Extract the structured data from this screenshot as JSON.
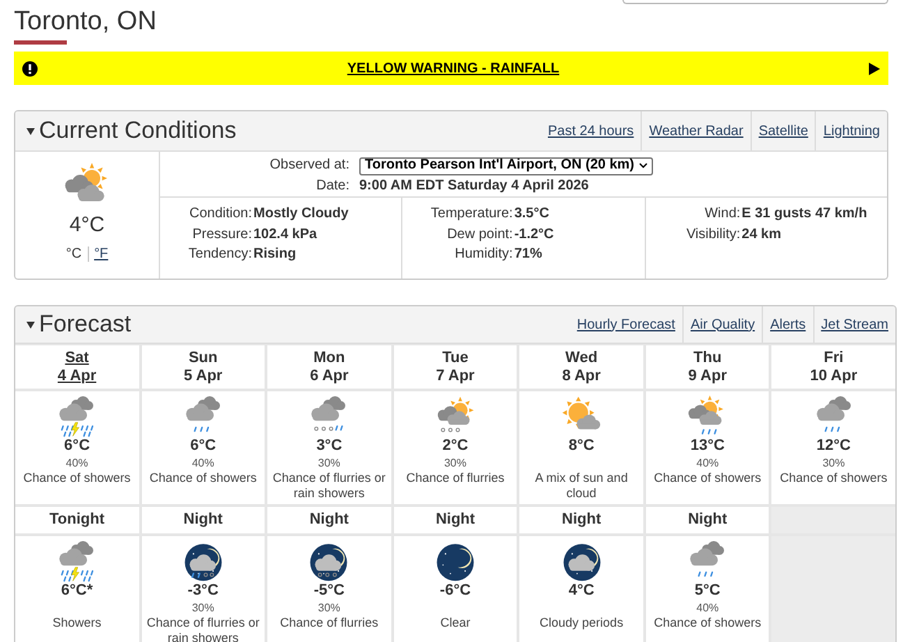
{
  "page_title": "Toronto, ON",
  "warning": {
    "text": "YELLOW WARNING - RAINFALL"
  },
  "current": {
    "title": "Current Conditions",
    "links": [
      "Past 24 hours",
      "Weather Radar",
      "Satellite",
      "Lightning"
    ],
    "kind": "mostly_cloudy",
    "temp": "4°C",
    "units": [
      {
        "label": "°C",
        "selected": true
      },
      {
        "label": "°F",
        "selected": false
      }
    ],
    "observed_label": "Observed at:",
    "station": "Toronto Pearson Int'l Airport, ON (20 km)",
    "date_label": "Date:",
    "date": "9:00 AM EDT Saturday 4 April 2026",
    "columns": [
      [
        {
          "label": "Condition:",
          "value": "Mostly Cloudy"
        },
        {
          "label": "Pressure:",
          "value": "102.4 kPa"
        },
        {
          "label": "Tendency:",
          "value": "Rising"
        }
      ],
      [
        {
          "label": "Temperature:",
          "value": "3.5°C"
        },
        {
          "label": "Dew point:",
          "value": "-1.2°C"
        },
        {
          "label": "Humidity:",
          "value": "71%"
        }
      ],
      [
        {
          "label": "Wind:",
          "value": "E 31 gusts 47 km/h"
        },
        {
          "label": "Visibility:",
          "value": "24 km"
        }
      ]
    ]
  },
  "forecast": {
    "title": "Forecast",
    "links": [
      "Hourly Forecast",
      "Air Quality",
      "Alerts",
      "Jet Stream"
    ],
    "days": [
      {
        "name": "Sat",
        "date": "4 Apr",
        "selected": true,
        "kind": "showers_thunder",
        "temp": "6°C",
        "pop": "40%",
        "summary": "Chance of showers"
      },
      {
        "name": "Sun",
        "date": "5 Apr",
        "selected": false,
        "kind": "showers",
        "temp": "6°C",
        "pop": "40%",
        "summary": "Chance of showers"
      },
      {
        "name": "Mon",
        "date": "6 Apr",
        "selected": false,
        "kind": "flurries_rain",
        "temp": "3°C",
        "pop": "30%",
        "summary": "Chance of flurries or rain showers"
      },
      {
        "name": "Tue",
        "date": "7 Apr",
        "selected": false,
        "kind": "flurries_sun",
        "temp": "2°C",
        "pop": "30%",
        "summary": "Chance of flurries"
      },
      {
        "name": "Wed",
        "date": "8 Apr",
        "selected": false,
        "kind": "sun_cloud",
        "temp": "8°C",
        "summary": "A mix of sun and cloud"
      },
      {
        "name": "Thu",
        "date": "9 Apr",
        "selected": false,
        "kind": "showers_sun",
        "temp": "13°C",
        "pop": "40%",
        "summary": "Chance of showers"
      },
      {
        "name": "Fri",
        "date": "10 Apr",
        "selected": false,
        "kind": "showers",
        "temp": "12°C",
        "pop": "30%",
        "summary": "Chance of showers"
      }
    ],
    "nights": [
      {
        "label": "Tonight",
        "kind": "showers_thunder",
        "temp": "6°C*",
        "summary": "Showers"
      },
      {
        "label": "Night",
        "kind": "night_flurries_rain",
        "temp": "-3°C",
        "pop": "30%",
        "summary": "Chance of flurries or rain showers"
      },
      {
        "label": "Night",
        "kind": "night_flurries",
        "temp": "-5°C",
        "pop": "30%",
        "summary": "Chance of flurries"
      },
      {
        "label": "Night",
        "kind": "night_clear",
        "temp": "-6°C",
        "summary": "Clear"
      },
      {
        "label": "Night",
        "kind": "night_cloudy",
        "temp": "4°C",
        "summary": "Cloudy periods"
      },
      {
        "label": "Night",
        "kind": "showers",
        "temp": "5°C",
        "pop": "40%",
        "summary": "Chance of showers"
      }
    ]
  }
}
